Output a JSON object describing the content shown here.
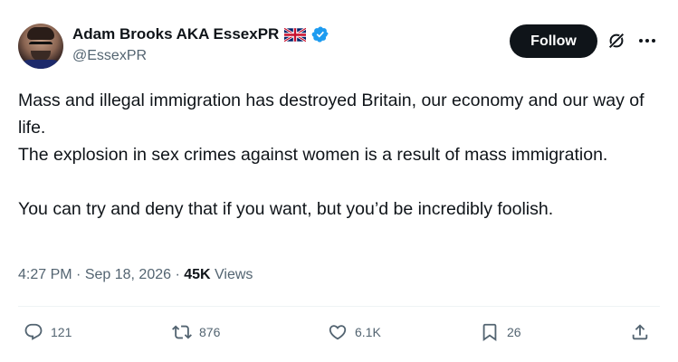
{
  "author": {
    "display_name": "Adam Brooks AKA EssexPR",
    "handle": "@EssexPR",
    "flag_icon": "uk-flag-icon",
    "verified_icon": "verified-badge-icon"
  },
  "header": {
    "follow_label": "Follow",
    "grok_icon": "grok-icon",
    "more_icon": "more-options-icon"
  },
  "tweet": {
    "lines": [
      "Mass and illegal immigration has destroyed Britain, our economy and our way of life.",
      "The explosion in sex crimes against women is a result of mass immigration.",
      "You can try and deny that if you want, but you’d be incredibly foolish."
    ]
  },
  "meta": {
    "time": "4:27 PM",
    "sep1": " · ",
    "date": "Sep 18, 2026",
    "sep2": " · ",
    "views_count": "45K",
    "views_label": " Views"
  },
  "actions": {
    "replies": "121",
    "reposts": "876",
    "likes": "6.1K",
    "bookmarks": "26"
  },
  "colors": {
    "text": "#0f1419",
    "muted": "#536471",
    "verified": "#1d9bf0",
    "follow_bg": "#0f1419"
  }
}
